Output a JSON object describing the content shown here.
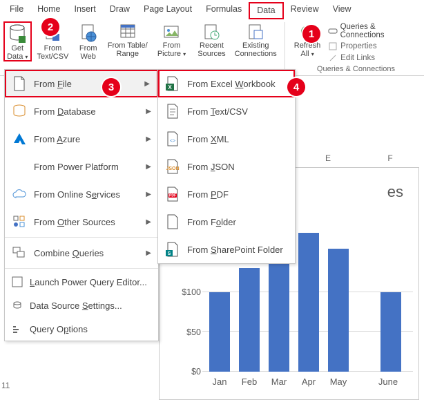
{
  "tabs": {
    "file": "File",
    "home": "Home",
    "insert": "Insert",
    "draw": "Draw",
    "page_layout": "Page Layout",
    "formulas": "Formulas",
    "data": "Data",
    "review": "Review",
    "view": "View"
  },
  "ribbon": {
    "get_data": "Get\nData",
    "from_text": "From\nText/CSV",
    "from_web": "From\nWeb",
    "from_table": "From Table/\nRange",
    "from_pic": "From\nPicture",
    "recent": "Recent\nSources",
    "existing": "Existing\nConnections",
    "refresh": "Refresh\nAll",
    "queries": "Queries & Connections",
    "properties": "Properties",
    "edit_links": "Edit Links",
    "group1": "Queries & Connections"
  },
  "menu1": {
    "from_file": "From File",
    "from_db": "From Database",
    "from_azure": "From Azure",
    "from_pp": "From Power Platform",
    "from_online": "From Online Services",
    "from_other": "From Other Sources",
    "combine": "Combine Queries",
    "pq": "Launch Power Query Editor...",
    "dss": "Data Source Settings...",
    "qo": "Query Options"
  },
  "menu2": {
    "excel": "From Excel Workbook",
    "text": "From Text/CSV",
    "xml": "From XML",
    "json": "From JSON",
    "pdf": "From PDF",
    "folder": "From Folder",
    "sp": "From SharePoint Folder"
  },
  "badges": {
    "1": "1",
    "2": "2",
    "3": "3",
    "4": "4"
  },
  "sheet": {
    "col_e": "E",
    "col_f": "F",
    "row": "11"
  },
  "chart_data": {
    "type": "bar",
    "title_partial": "es",
    "categories": [
      "Jan",
      "Feb",
      "Mar",
      "Apr",
      "May",
      "June"
    ],
    "values": [
      100,
      130,
      140,
      175,
      155,
      100
    ],
    "ylabels": [
      "$100",
      "$50",
      "$0"
    ],
    "ylim": [
      0,
      200
    ],
    "gap_after_index": 4
  }
}
